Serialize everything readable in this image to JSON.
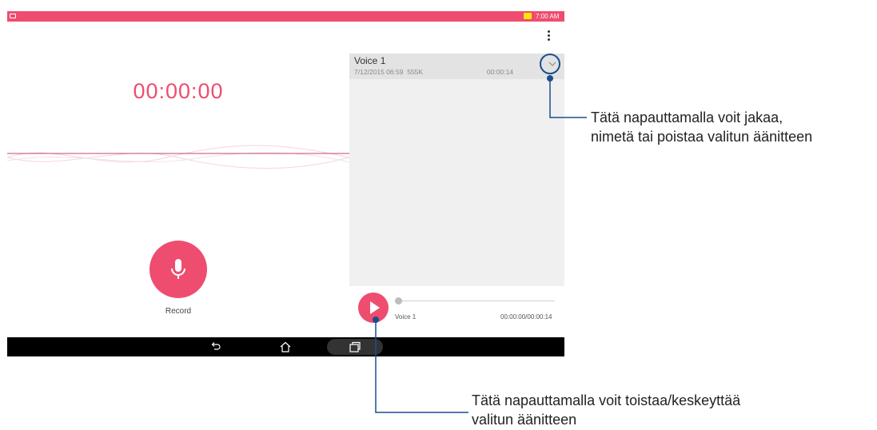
{
  "status_bar": {
    "time": "7:00 AM"
  },
  "recorder": {
    "timer": "00:00:00",
    "record_label": "Record"
  },
  "recording_list": [
    {
      "title": "Voice 1",
      "date": "7/12/2015 06:59",
      "size": "555K",
      "duration": "00:00:14"
    }
  ],
  "player": {
    "track_name": "Voice 1",
    "time": "00:00:00/00:00:14",
    "progress": 0
  },
  "callouts": {
    "options": [
      "Tätä napauttamalla voit jakaa,",
      "nimetä tai poistaa valitun äänitteen"
    ],
    "play": [
      "Tätä napauttamalla voit toistaa/keskeyttää",
      "valitun äänitteen"
    ]
  },
  "colors": {
    "accent": "#ee4d6f",
    "callout": "#1a4f8c"
  },
  "icons": [
    "battery-icon",
    "overflow-menu-icon",
    "microphone-icon",
    "chevron-down-icon",
    "play-icon",
    "back-icon",
    "home-icon",
    "recents-icon"
  ]
}
